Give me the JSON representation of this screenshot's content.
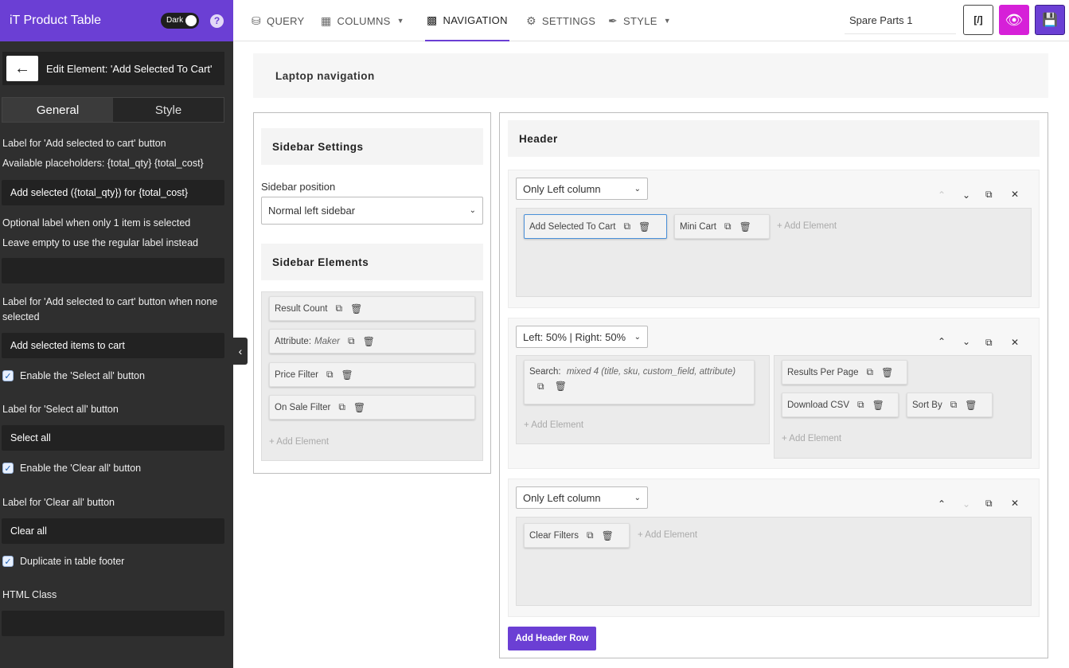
{
  "app": {
    "title": "iT Product Table",
    "dark_label": "Dark",
    "help": "?"
  },
  "edit": {
    "title": "Edit Element: 'Add Selected To Cart'"
  },
  "panel_tabs": [
    "General",
    "Style"
  ],
  "form": {
    "label_add": "Label for 'Add selected to cart' button",
    "placeholders": "Available placeholders: {total_qty} {total_cost}",
    "add_value": "Add selected ({total_qty}) for {total_cost}",
    "optional_label": "Optional label when only 1 item is selected",
    "optional_hint": "Leave empty to use the regular label instead",
    "optional_value": "",
    "none_label_1": "Label for 'Add selected to cart' button when none",
    "none_label_2": "selected",
    "none_value": "Add selected items to cart",
    "enable_select_all": "Enable the 'Select all' button",
    "select_all_label": "Label for 'Select all' button",
    "select_all_value": "Select all",
    "enable_clear_all": "Enable the 'Clear all' button",
    "clear_all_label": "Label for 'Clear all' button",
    "clear_all_value": "Clear all",
    "duplicate_footer": "Duplicate in table footer",
    "html_class_label": "HTML Class",
    "html_class_value": ""
  },
  "nav": {
    "query": "QUERY",
    "columns": "COLUMNS",
    "navigation": "NAVIGATION",
    "settings": "SETTINGS",
    "style": "STYLE",
    "table_name": "Spare Parts 1",
    "code_btn": "[/]"
  },
  "main": {
    "laptop_title": "Laptop navigation",
    "sidebar_settings": "Sidebar Settings",
    "sidebar_position_label": "Sidebar position",
    "sidebar_position_value": "Normal left sidebar",
    "sidebar_elements": "Sidebar Elements",
    "sidebar_items": [
      "Result Count",
      "Attribute:",
      "Price Filter",
      "On Sale Filter"
    ],
    "attribute_value": "Maker",
    "add_element": "+ Add Element",
    "header": "Header",
    "row1_layout": "Only Left column",
    "row1_items": [
      "Add Selected To Cart",
      "Mini Cart"
    ],
    "row2_layout": "Left: 50% | Right: 50%",
    "row2_left": "Search:",
    "row2_left_detail": "mixed 4 (title, sku, custom_field, attribute)",
    "row2_right": [
      "Results Per Page",
      "Download CSV",
      "Sort By"
    ],
    "row3_layout": "Only Left column",
    "row3_items": [
      "Clear Filters"
    ],
    "add_header_row": "Add Header Row"
  },
  "colors": {
    "brand": "#6b3fd4",
    "preview": "#d620d8",
    "sidebar_bg": "#2f2f2f"
  }
}
